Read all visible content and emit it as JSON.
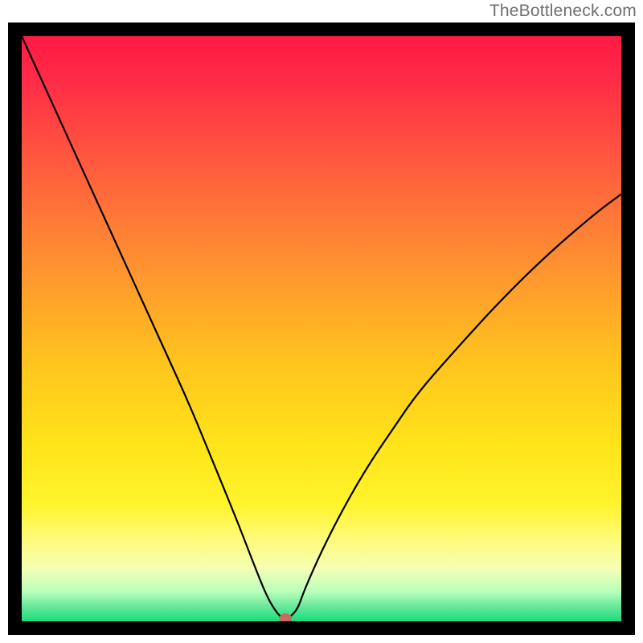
{
  "watermark": "TheBottleneck.com",
  "chart_data": {
    "type": "line",
    "title": "",
    "xlabel": "",
    "ylabel": "",
    "xlim": [
      0,
      100
    ],
    "ylim": [
      0,
      100
    ],
    "background_gradient": {
      "stops": [
        {
          "offset": 0.0,
          "color": "#ff1a44"
        },
        {
          "offset": 0.08,
          "color": "#ff2d46"
        },
        {
          "offset": 0.22,
          "color": "#ff5b3e"
        },
        {
          "offset": 0.38,
          "color": "#ff8e32"
        },
        {
          "offset": 0.55,
          "color": "#ffc21e"
        },
        {
          "offset": 0.7,
          "color": "#ffe41a"
        },
        {
          "offset": 0.8,
          "color": "#fff42c"
        },
        {
          "offset": 0.86,
          "color": "#fffb7a"
        },
        {
          "offset": 0.91,
          "color": "#f4ffb4"
        },
        {
          "offset": 0.95,
          "color": "#b8ffba"
        },
        {
          "offset": 0.975,
          "color": "#67e89a"
        },
        {
          "offset": 1.0,
          "color": "#18dd7e"
        }
      ]
    },
    "series": [
      {
        "name": "bottleneck-curve",
        "x": [
          0,
          4,
          8,
          12,
          16,
          20,
          24,
          28,
          32,
          36,
          39,
          41,
          42.5,
          43.5,
          44.5,
          46,
          47,
          50,
          54,
          58,
          62,
          66,
          72,
          80,
          88,
          96,
          100
        ],
        "y": [
          100,
          91,
          82,
          73,
          64,
          55,
          46,
          37,
          27,
          17,
          9,
          4,
          1.5,
          0.5,
          0.5,
          2,
          5,
          12,
          20,
          27,
          33,
          39,
          46,
          55,
          63,
          70,
          73
        ]
      }
    ],
    "marker": {
      "x": 44,
      "y": 0.5,
      "color": "#c96b5e"
    },
    "curve_color": "#000000"
  }
}
